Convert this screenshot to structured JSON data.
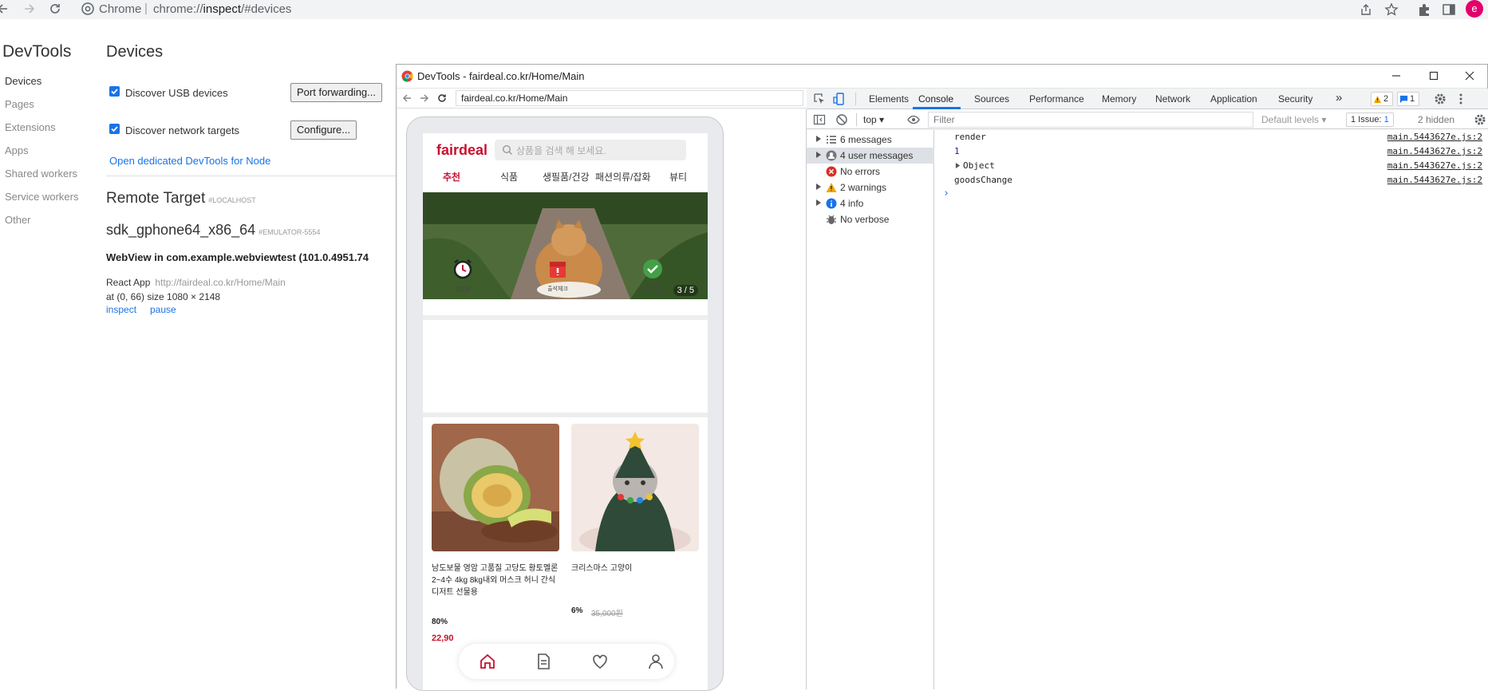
{
  "browser": {
    "omnibox_app": "Chrome",
    "omnibox_sep": "|",
    "url_scheme": "chrome://",
    "url_host": "inspect",
    "url_path": "/#devices",
    "avatar_letter": "e"
  },
  "inspect": {
    "title": "DevTools",
    "sidebar": [
      {
        "label": "Devices",
        "active": true
      },
      {
        "label": "Pages",
        "active": false
      },
      {
        "label": "Extensions",
        "active": false
      },
      {
        "label": "Apps",
        "active": false
      },
      {
        "label": "Shared workers",
        "active": false
      },
      {
        "label": "Service workers",
        "active": false
      },
      {
        "label": "Other",
        "active": false
      }
    ],
    "devices_title": "Devices",
    "discover_usb": "Discover USB devices",
    "port_forwarding": "Port forwarding...",
    "discover_network": "Discover network targets",
    "configure": "Configure...",
    "node_link": "Open dedicated DevTools for Node",
    "remote_target": "Remote Target",
    "remote_tag": "#LOCALHOST",
    "device_name": "sdk_gphone64_x86_64",
    "device_tag": "#EMULATOR-5554",
    "webview": "WebView in com.example.webviewtest (101.0.4951.74",
    "app_name": "React App",
    "app_url": "http://fairdeal.co.kr/Home/Main",
    "app_geometry": "at (0, 66)  size 1080 × 2148",
    "inspect_link": "inspect",
    "pause_link": "pause"
  },
  "devtools_window": {
    "title": "DevTools - fairdeal.co.kr/Home/Main",
    "screencast_url": "fairdeal.co.kr/Home/Main"
  },
  "phone": {
    "logo": "fairdeal",
    "search_placeholder": "상품을 검색 해 보세요.",
    "categories": [
      "추천",
      "식품",
      "생필품/건강",
      "패션의류/잡화",
      "뷰티"
    ],
    "banner_counter": "3 / 5",
    "quick_menu": [
      "타임딜",
      "출석체크",
      "팀추천"
    ],
    "products": [
      {
        "name_line1": "남도보물 영암 고품질 고당도 황토멜론",
        "name_line2": "2~4수 4kg 8kg내외 머스크 허니 간식",
        "name_line3": "디저트 선물용",
        "discount": "80%",
        "old_price": "",
        "price": "22,90"
      },
      {
        "name_line1": "크리스마스 고양이",
        "name_line2": "",
        "name_line3": "",
        "discount": "6%",
        "old_price": "35,000원",
        "price": ""
      }
    ]
  },
  "devtools": {
    "tabs": [
      "Elements",
      "Console",
      "Sources",
      "Performance",
      "Memory",
      "Network",
      "Application",
      "Security"
    ],
    "active_tab": "Console",
    "more": "»",
    "warn_count": "2",
    "msg_count": "1",
    "context": "top",
    "filter_placeholder": "Filter",
    "levels": "Default levels",
    "issues_label": "1 Issue:",
    "issues_count": "1",
    "hidden": "2 hidden",
    "sidebar": [
      {
        "label": "6 messages",
        "icon": "list-icon"
      },
      {
        "label": "4 user messages",
        "icon": "user-icon"
      },
      {
        "label": "No errors",
        "icon": "error-icon"
      },
      {
        "label": "2 warnings",
        "icon": "warning-icon"
      },
      {
        "label": "4 info",
        "icon": "info-icon"
      },
      {
        "label": "No verbose",
        "icon": "bug-icon"
      }
    ],
    "console": [
      {
        "text": "render",
        "src": "main.5443627e.js:2"
      },
      {
        "text": "1",
        "src": "main.5443627e.js:2"
      },
      {
        "text": "Object",
        "src": "main.5443627e.js:2"
      },
      {
        "text": "goodsChange",
        "src": "main.5443627e.js:2"
      }
    ],
    "prompt": "›"
  },
  "colors": {
    "accent": "#1a73e8",
    "brand": "#c8102e",
    "avatar": "#e4006b"
  }
}
